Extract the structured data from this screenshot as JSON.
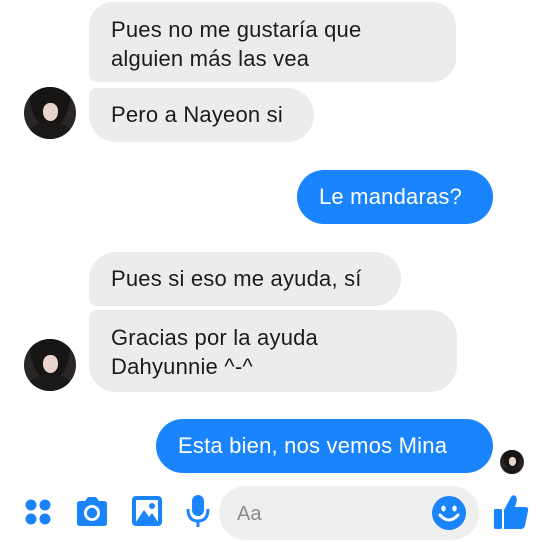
{
  "messages": [
    {
      "side": "in",
      "text": "Pues no me gustaría que\nalguien más las vea"
    },
    {
      "side": "in",
      "text": "Pero a Nayeon si"
    },
    {
      "side": "out",
      "text": "Le mandaras?"
    },
    {
      "side": "in",
      "text": "Pues si eso me ayuda, sí"
    },
    {
      "side": "in",
      "text": "Gracias por la ayuda\nDahyunnie ^-^"
    },
    {
      "side": "out",
      "text": "Esta bien, nos vemos Mina"
    }
  ],
  "composer": {
    "placeholder": "Aa"
  },
  "icons": {
    "apps": "apps-grid-icon",
    "camera": "camera-icon",
    "gallery": "image-gallery-icon",
    "mic": "microphone-icon",
    "emoji": "emoji-icon",
    "like": "thumbs-up-icon"
  },
  "colors": {
    "accent": "#1a84fc",
    "incoming_bubble": "#ececec"
  }
}
